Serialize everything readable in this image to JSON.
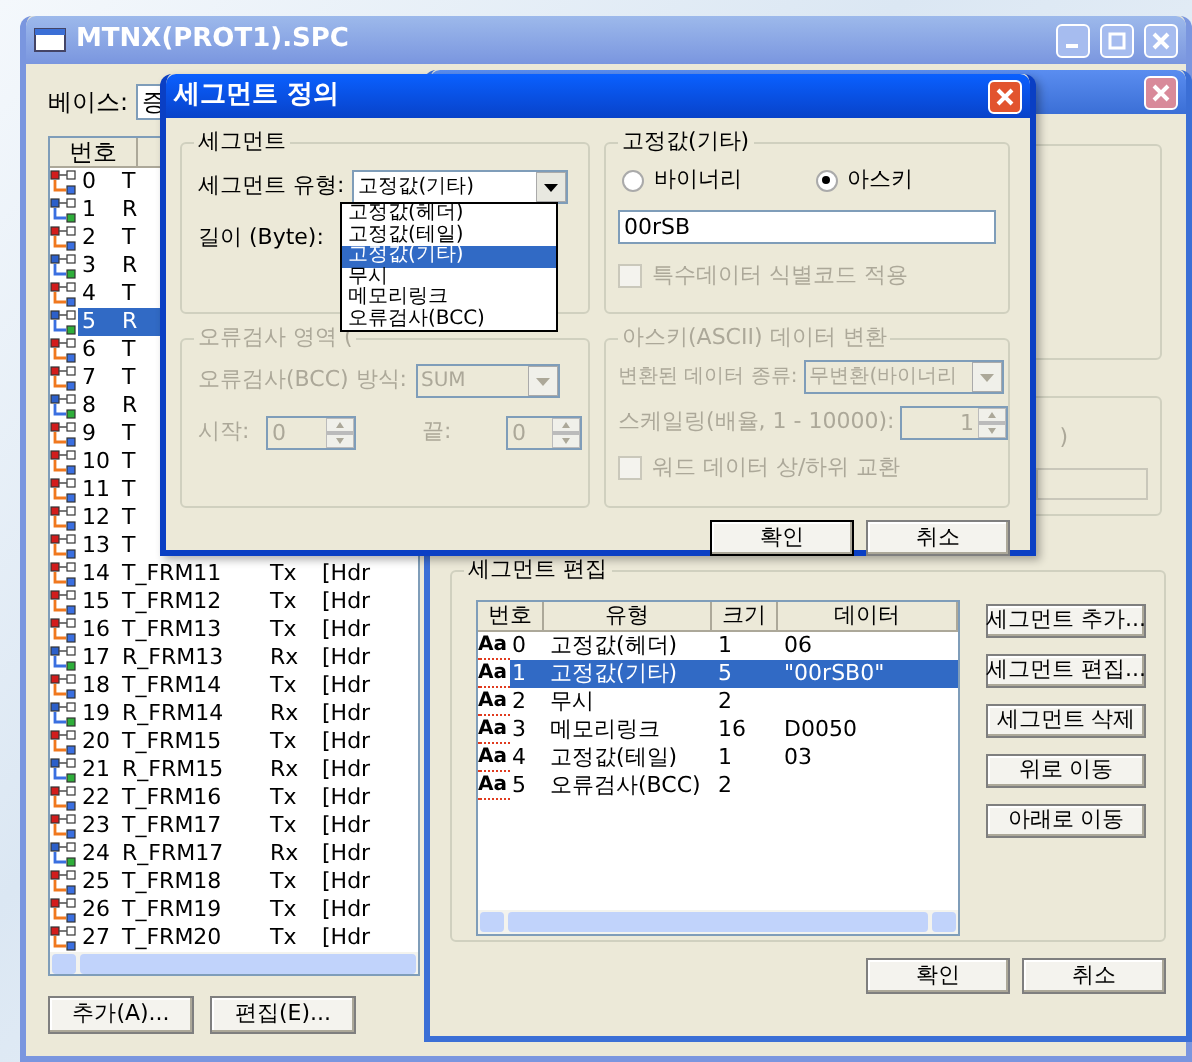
{
  "main_window": {
    "title": "MTNX(PROT1).SPC",
    "base_label": "베이스:",
    "base_value": "증",
    "column": "번호",
    "rows": [
      {
        "kind": "tx",
        "number": "0",
        "name": "T",
        "selected": false
      },
      {
        "kind": "rx",
        "number": "1",
        "name": "R",
        "selected": false
      },
      {
        "kind": "tx",
        "number": "2",
        "name": "T",
        "selected": false
      },
      {
        "kind": "rx",
        "number": "3",
        "name": "R",
        "selected": false
      },
      {
        "kind": "tx",
        "number": "4",
        "name": "T",
        "selected": false
      },
      {
        "kind": "rx",
        "number": "5",
        "name": "R",
        "selected": true
      },
      {
        "kind": "tx",
        "number": "6",
        "name": "T",
        "selected": false
      },
      {
        "kind": "tx",
        "number": "7",
        "name": "T",
        "selected": false
      },
      {
        "kind": "rx",
        "number": "8",
        "name": "R",
        "selected": false
      },
      {
        "kind": "tx",
        "number": "9",
        "name": "T",
        "selected": false
      },
      {
        "kind": "tx",
        "number": "10",
        "name": "T",
        "selected": false
      },
      {
        "kind": "tx",
        "number": "11",
        "name": "T",
        "selected": false
      },
      {
        "kind": "tx",
        "number": "12",
        "name": "T",
        "selected": false
      },
      {
        "kind": "tx",
        "number": "13",
        "name": "T",
        "selected": false
      },
      {
        "kind": "tx",
        "number": "14",
        "name": "T_FRM11",
        "direction": "Tx",
        "data": "[Hdr",
        "selected": false
      },
      {
        "kind": "tx",
        "number": "15",
        "name": "T_FRM12",
        "direction": "Tx",
        "data": "[Hdr",
        "selected": false
      },
      {
        "kind": "tx",
        "number": "16",
        "name": "T_FRM13",
        "direction": "Tx",
        "data": "[Hdr",
        "selected": false
      },
      {
        "kind": "rx",
        "number": "17",
        "name": "R_FRM13",
        "direction": "Rx",
        "data": "[Hdr",
        "selected": false
      },
      {
        "kind": "tx",
        "number": "18",
        "name": "T_FRM14",
        "direction": "Tx",
        "data": "[Hdr",
        "selected": false
      },
      {
        "kind": "rx",
        "number": "19",
        "name": "R_FRM14",
        "direction": "Rx",
        "data": "[Hdr",
        "selected": false
      },
      {
        "kind": "tx",
        "number": "20",
        "name": "T_FRM15",
        "direction": "Tx",
        "data": "[Hdr",
        "selected": false
      },
      {
        "kind": "rx",
        "number": "21",
        "name": "R_FRM15",
        "direction": "Rx",
        "data": "[Hdr",
        "selected": false
      },
      {
        "kind": "tx",
        "number": "22",
        "name": "T_FRM16",
        "direction": "Tx",
        "data": "[Hdr",
        "selected": false
      },
      {
        "kind": "tx",
        "number": "23",
        "name": "T_FRM17",
        "direction": "Tx",
        "data": "[Hdr",
        "selected": false
      },
      {
        "kind": "rx",
        "number": "24",
        "name": "R_FRM17",
        "direction": "Rx",
        "data": "[Hdr",
        "selected": false
      },
      {
        "kind": "tx",
        "number": "25",
        "name": "T_FRM18",
        "direction": "Tx",
        "data": "[Hdr",
        "selected": false
      },
      {
        "kind": "tx",
        "number": "26",
        "name": "T_FRM19",
        "direction": "Tx",
        "data": "[Hdr",
        "selected": false
      },
      {
        "kind": "tx",
        "number": "27",
        "name": "T_FRM20",
        "direction": "Tx",
        "data": "[Hdr",
        "selected": false
      }
    ],
    "buttons": [
      "추가(A)...",
      "편집(E)..."
    ]
  },
  "segment_window": {
    "side_text": ")",
    "group_label": "세그먼트 편집",
    "columns": [
      "번호",
      "유형",
      "크기",
      "데이터"
    ],
    "rows": [
      {
        "icon": "Aa",
        "number": "0",
        "type": "고정값(헤더)",
        "size": "1",
        "data": "06",
        "selected": false
      },
      {
        "icon": "Aa",
        "number": "1",
        "type": "고정값(기타)",
        "size": "5",
        "data": "\"00rSB0\"",
        "selected": true
      },
      {
        "icon": "Aa",
        "number": "2",
        "type": "무시",
        "size": "2",
        "selected": false
      },
      {
        "icon": "Aa",
        "number": "3",
        "type": "메모리링크",
        "size": "16",
        "data": "D0050",
        "selected": false
      },
      {
        "icon": "Aa",
        "number": "4",
        "type": "고정값(테일)",
        "size": "1",
        "data": "03",
        "selected": false
      },
      {
        "icon": "Aa",
        "number": "5",
        "type": "오류검사(BCC)",
        "size": "2",
        "selected": false
      }
    ],
    "side_buttons": [
      "세그먼트 추가...",
      "세그먼트 편집...",
      "세그먼트 삭제",
      "위로 이동",
      "아래로 이동"
    ],
    "buttons": [
      "확인",
      "취소"
    ]
  },
  "dialog": {
    "title": "세그먼트 정의",
    "segment_group": {
      "label": "세그먼트",
      "type_label": "세그먼트 유형:",
      "type_value": "고정값(기타)",
      "length_label": "길이 (Byte):",
      "dropdown": [
        {
          "label": "고정값(헤더)",
          "selected": false
        },
        {
          "label": "고정값(테일)",
          "selected": false
        },
        {
          "label": "고정값(기타)",
          "selected": true
        },
        {
          "label": "무시",
          "selected": false
        },
        {
          "label": "메모리링크",
          "selected": false
        },
        {
          "label": "오류검사(BCC)",
          "selected": false
        }
      ]
    },
    "bcc_group": {
      "label": "오류검사 영역 (",
      "disabled": true,
      "method_label": "오류검사(BCC) 방식:",
      "method_value": "SUM",
      "start_label": "시작:",
      "start_value": "0",
      "end_label": "끝:",
      "end_value": "0"
    },
    "fixed_group": {
      "label": "고정값(기타)",
      "radios": [
        {
          "label": "바이너리",
          "selected": false
        },
        {
          "label": "아스키",
          "selected": true
        }
      ],
      "value": "00rSB",
      "special_check": {
        "label": "특수데이터 식별코드 적용",
        "checked": false,
        "disabled": true
      }
    },
    "ascii_group": {
      "label": "아스키(ASCII) 데이터 변환",
      "disabled": true,
      "type_label": "변환된 데이터 종류:",
      "type_value": "무변환(바이너리",
      "scale_label": "스케일링(배율, 1 - 10000):",
      "scale_value": "1",
      "swap_check": {
        "label": "워드 데이터 상/하위 교환",
        "checked": false
      }
    },
    "buttons": [
      "확인",
      "취소"
    ]
  }
}
